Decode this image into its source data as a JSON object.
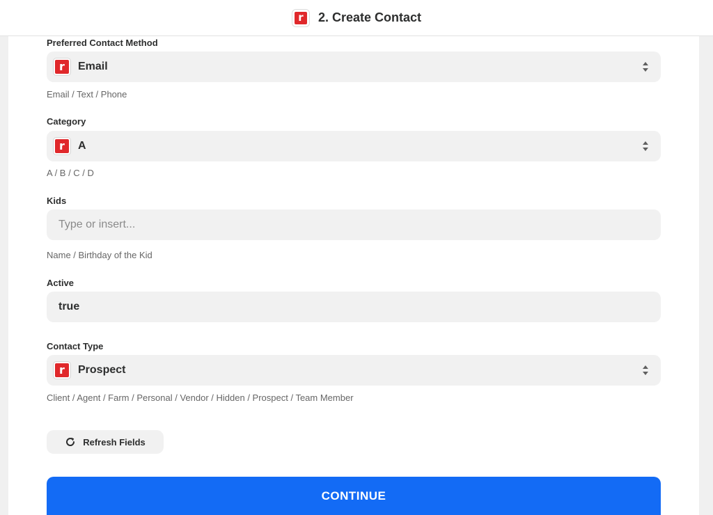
{
  "header": {
    "title": "2. Create Contact",
    "logo_letter": "r",
    "brand_color": "#e0282b"
  },
  "fields": {
    "preferred_contact_method": {
      "label": "Preferred Contact Method",
      "value": "Email",
      "hint": "Email / Text / Phone"
    },
    "category": {
      "label": "Category",
      "value": "A",
      "hint": "A / B / C / D"
    },
    "kids": {
      "label": "Kids",
      "placeholder": "Type or insert...",
      "hint": "Name / Birthday of the Kid"
    },
    "active": {
      "label": "Active",
      "value": "true"
    },
    "contact_type": {
      "label": "Contact Type",
      "value": "Prospect",
      "hint": "Client / Agent / Farm / Personal / Vendor / Hidden / Prospect / Team Member"
    }
  },
  "actions": {
    "refresh_label": "Refresh Fields",
    "continue_label": "CONTINUE",
    "continue_color": "#136bf5"
  },
  "icons": {
    "app": "roomvu-app-icon",
    "select_arrows": "select-updown-chevron-icon",
    "refresh": "refresh-icon"
  }
}
